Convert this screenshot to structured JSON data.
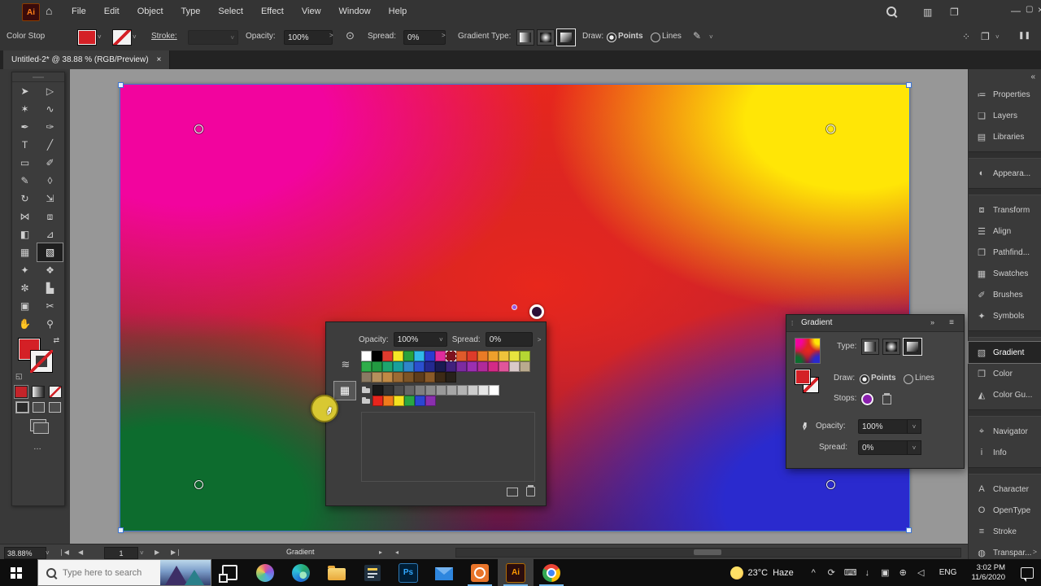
{
  "icons": {
    "close": "×",
    "chevron_down": "˅",
    "chevron_right": ">",
    "minimize": "—",
    "restore": "▢",
    "menu": "≡",
    "collapse_left": "«",
    "collapse_right": "»",
    "grip": "⁞",
    "more": "…",
    "panel_ws1": "⁘",
    "panel_ws2": "❐",
    "pause": "❚❚",
    "annotator": "⊙",
    "edit_gradient": "✎",
    "home": "⌂",
    "scroll_right": "▸",
    "scroll_left": "◂",
    "nav_first": "◀",
    "nav_prev": "◀",
    "nav_next": "▶",
    "nav_last": "▶",
    "dropper": "✒",
    "mixer": "≋",
    "swatch_grid": "▦"
  },
  "menubar": {
    "items": [
      "File",
      "Edit",
      "Object",
      "Type",
      "Select",
      "Effect",
      "View",
      "Window",
      "Help"
    ]
  },
  "control_bar": {
    "color_stop_label": "Color Stop",
    "stroke_label": "Stroke:",
    "opacity_label": "Opacity:",
    "opacity_value": "100%",
    "spread_label": "Spread:",
    "spread_value": "0%",
    "gradient_type_label": "Gradient Type:",
    "draw_label": "Draw:",
    "points_label": "Points",
    "lines_label": "Lines"
  },
  "document_tab": {
    "title": "Untitled-2* @ 38.88 % (RGB/Preview)"
  },
  "toolbar": {
    "tools": [
      {
        "name": "selection-tool",
        "glyph": "➤"
      },
      {
        "name": "direct-selection-tool",
        "glyph": "▷"
      },
      {
        "name": "magic-wand-tool",
        "glyph": "✶"
      },
      {
        "name": "lasso-tool",
        "glyph": "∿"
      },
      {
        "name": "pen-tool",
        "glyph": "✒"
      },
      {
        "name": "curvature-tool",
        "glyph": "✑"
      },
      {
        "name": "type-tool",
        "glyph": "T"
      },
      {
        "name": "line-segment-tool",
        "glyph": "╱"
      },
      {
        "name": "rectangle-tool",
        "glyph": "▭"
      },
      {
        "name": "paintbrush-tool",
        "glyph": "✐"
      },
      {
        "name": "pencil-tool",
        "glyph": "✎"
      },
      {
        "name": "eraser-tool",
        "glyph": "◊"
      },
      {
        "name": "rotate-tool",
        "glyph": "↻"
      },
      {
        "name": "scale-tool",
        "glyph": "⇲"
      },
      {
        "name": "width-tool",
        "glyph": "⋈"
      },
      {
        "name": "free-transform-tool",
        "glyph": "⧈"
      },
      {
        "name": "shape-builder-tool",
        "glyph": "◧"
      },
      {
        "name": "perspective-grid-tool",
        "glyph": "⊿"
      },
      {
        "name": "mesh-tool",
        "glyph": "▦"
      },
      {
        "name": "gradient-tool",
        "glyph": "▧",
        "selected": true
      },
      {
        "name": "eyedropper-tool",
        "glyph": "✦"
      },
      {
        "name": "blend-tool",
        "glyph": "❖"
      },
      {
        "name": "symbol-sprayer-tool",
        "glyph": "✼"
      },
      {
        "name": "column-graph-tool",
        "glyph": "▙"
      },
      {
        "name": "artboard-tool",
        "glyph": "▣"
      },
      {
        "name": "slice-tool",
        "glyph": "✂"
      },
      {
        "name": "hand-tool",
        "glyph": "✋"
      },
      {
        "name": "zoom-tool",
        "glyph": "⚲"
      }
    ]
  },
  "artwork": {
    "top_left": "#f2049e",
    "top_right": "#ffe606",
    "bottom_left": "#0d6c2e",
    "bottom_right": "#2a2ace",
    "center": "#e8271c",
    "bottom_mid": "#5c1648"
  },
  "swatches_panel": {
    "opacity_label": "Opacity:",
    "opacity_value": "100%",
    "spread_label": "Spread:",
    "spread_value": "0%",
    "rows": [
      {
        "folder": false,
        "colors": [
          "#ffffff",
          "#000000",
          "#e23b2e",
          "#f6e826",
          "#2aa23c",
          "#30b9e9",
          "#2b3bd0",
          "#e02b9d",
          "REG",
          "#df5b2b",
          "#de3b2a",
          "#e97b26",
          "#efa02c",
          "#eec33b",
          "#e7e43e",
          "#b5d733"
        ]
      },
      {
        "folder": false,
        "colors": [
          "#2fae4a",
          "#229a41",
          "#1ea56e",
          "#18a09b",
          "#2f86c9",
          "#2b50cf",
          "#24298f",
          "#1a1b52",
          "#41217d",
          "#7c2ba0",
          "#9a2fb0",
          "#b02a9a",
          "#d32a86",
          "#e0559a",
          "#d9c9c9",
          "#b9aa8e"
        ]
      },
      {
        "folder": false,
        "colors": [
          "#8a7a63",
          "#b5905c",
          "#c08a45",
          "#9c6b33",
          "#7d5426",
          "#5e3d1c",
          "#8a5a28",
          "#3d2a16",
          "#27211a"
        ]
      },
      {
        "folder": true,
        "colors": [
          "#191919",
          "#333333",
          "#4d4d4d",
          "#666666",
          "#7f7f7f",
          "#8c8c8c",
          "#999999",
          "#a6a6a6",
          "#b3b3b3",
          "#cccccc",
          "#e6e6e6",
          "#ffffff"
        ]
      },
      {
        "folder": true,
        "colors": [
          "#e8251d",
          "#f07b1c",
          "#f5e21f",
          "#2aa643",
          "#2b46d2",
          "#8a2fae"
        ]
      }
    ]
  },
  "gradient_panel": {
    "title": "Gradient",
    "type_label": "Type:",
    "draw_label": "Draw:",
    "points_label": "Points",
    "lines_label": "Lines",
    "stops_label": "Stops:",
    "opacity_label": "Opacity:",
    "opacity_value": "100%",
    "spread_label": "Spread:",
    "spread_value": "0%"
  },
  "right_dock": {
    "groups": [
      {
        "items": [
          {
            "name": "properties",
            "label": "Properties",
            "glyph": "≔"
          },
          {
            "name": "layers",
            "label": "Layers",
            "glyph": "❏"
          },
          {
            "name": "libraries",
            "label": "Libraries",
            "glyph": "▤"
          }
        ]
      },
      {
        "items": [
          {
            "name": "appearance",
            "label": "Appeara...",
            "glyph": "◐"
          }
        ]
      },
      {
        "items": [
          {
            "name": "transform",
            "label": "Transform",
            "glyph": "⧈"
          },
          {
            "name": "align",
            "label": "Align",
            "glyph": "☰"
          },
          {
            "name": "pathfinder",
            "label": "Pathfind...",
            "glyph": "❐"
          },
          {
            "name": "swatches",
            "label": "Swatches",
            "glyph": "▦"
          },
          {
            "name": "brushes",
            "label": "Brushes",
            "glyph": "✐"
          },
          {
            "name": "symbols",
            "label": "Symbols",
            "glyph": "✦"
          }
        ]
      },
      {
        "items": [
          {
            "name": "gradient",
            "label": "Gradient",
            "glyph": "▧",
            "selected": true
          },
          {
            "name": "color",
            "label": "Color",
            "glyph": "❒"
          },
          {
            "name": "color-guide",
            "label": "Color Gu...",
            "glyph": "◭"
          }
        ]
      },
      {
        "items": [
          {
            "name": "navigator",
            "label": "Navigator",
            "glyph": "⌖"
          },
          {
            "name": "info",
            "label": "Info",
            "glyph": "i"
          }
        ]
      },
      {
        "items": [
          {
            "name": "character",
            "label": "Character",
            "glyph": "A"
          },
          {
            "name": "opentype",
            "label": "OpenType",
            "glyph": "O"
          },
          {
            "name": "stroke",
            "label": "Stroke",
            "glyph": "≡"
          },
          {
            "name": "transparency",
            "label": "Transpar...",
            "glyph": "◍"
          }
        ]
      }
    ]
  },
  "status_bar": {
    "zoom_value": "38.88%",
    "artboard_value": "1",
    "status_text": "Gradient"
  },
  "taskbar": {
    "search_placeholder": "Type here to search",
    "apps": [
      {
        "name": "task-view-button",
        "kind": "taskview"
      },
      {
        "name": "cortana-app",
        "kind": "cortana"
      },
      {
        "name": "edge-browser",
        "kind": "edge"
      },
      {
        "name": "file-explorer",
        "kind": "folder"
      },
      {
        "name": "notes-app",
        "kind": "notes"
      },
      {
        "name": "photoshop-app",
        "kind": "ps",
        "label": "Ps"
      },
      {
        "name": "mail-app",
        "kind": "mail"
      },
      {
        "name": "screen-recorder-app",
        "kind": "rec",
        "underline": true
      },
      {
        "name": "illustrator-app",
        "kind": "ai",
        "label": "Ai",
        "active": true,
        "underline": true
      },
      {
        "name": "chrome-browser",
        "kind": "chrome",
        "underline": true
      }
    ],
    "weather_temp": "23°C",
    "weather_desc": "Haze",
    "tray_icons": [
      {
        "name": "hidden-icons-chevron",
        "glyph": "^"
      },
      {
        "name": "update-icon",
        "glyph": "⟳"
      },
      {
        "name": "keyboard-icon",
        "glyph": "⌨"
      },
      {
        "name": "mic-icon",
        "glyph": "↓"
      },
      {
        "name": "display-icon",
        "glyph": "▣"
      },
      {
        "name": "network-icon",
        "glyph": "⊕"
      },
      {
        "name": "volume-icon",
        "glyph": "◁"
      }
    ],
    "language": "ENG",
    "time": "3:02 PM",
    "date": "11/6/2020"
  }
}
